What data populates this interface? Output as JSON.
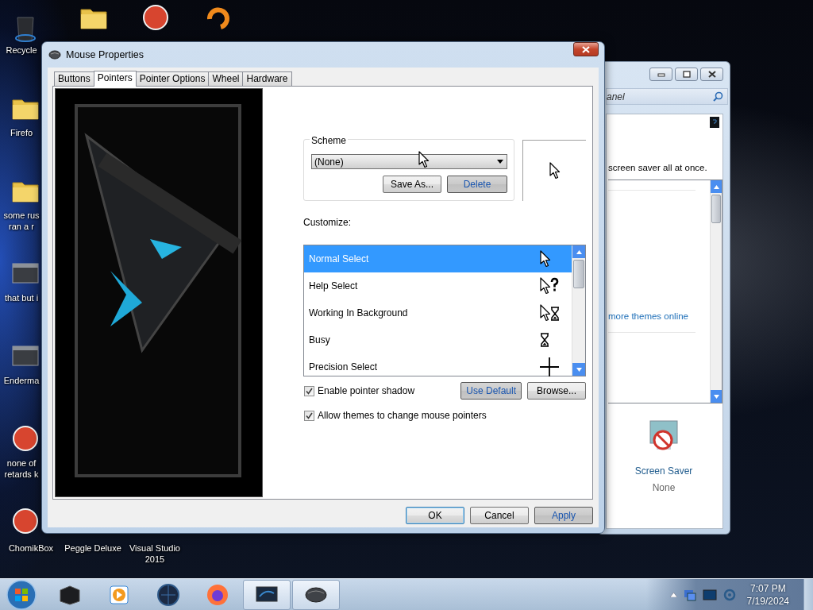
{
  "desktop_icons": [
    {
      "kind": "bin",
      "lines": [
        "Recycle"
      ]
    },
    {
      "kind": "folder",
      "lines": [
        "Firefo"
      ]
    },
    {
      "kind": "folder",
      "lines": [
        "some rus",
        "ran a r"
      ]
    },
    {
      "kind": "window",
      "lines": [
        "that but i"
      ]
    },
    {
      "kind": "window",
      "lines": [
        "Enderma"
      ]
    },
    {
      "kind": "app",
      "lines": [
        "none of",
        "retards k"
      ]
    },
    {
      "kind": "app",
      "lines": [
        "ChomikBox"
      ]
    },
    {
      "kind": "folder"
    },
    {
      "kind": "app"
    },
    {
      "kind": "ring"
    },
    {
      "lines": [
        "Peggle Deluxe"
      ]
    },
    {
      "lines": [
        "Visual Studio",
        "2015"
      ]
    }
  ],
  "background_window": {
    "search_placeholder": "anel",
    "description": "screen saver all at once.",
    "link": "more themes online",
    "screen_saver": {
      "label": "Screen Saver",
      "value": "None"
    }
  },
  "dialog": {
    "title": "Mouse Properties",
    "tabs": [
      {
        "label": "Buttons",
        "selected": false
      },
      {
        "label": "Pointers",
        "selected": true
      },
      {
        "label": "Pointer Options",
        "selected": false
      },
      {
        "label": "Wheel",
        "selected": false
      },
      {
        "label": "Hardware",
        "selected": false
      }
    ],
    "scheme": {
      "label": "Scheme",
      "value": "(None)",
      "buttons": [
        {
          "label": "Save As...",
          "disabled": false
        },
        {
          "label": "Delete",
          "disabled": true
        }
      ]
    },
    "customize_label": "Customize:",
    "pointers": [
      {
        "name": "Normal Select",
        "kind": "arrow",
        "selected": true
      },
      {
        "name": "Help Select",
        "kind": "help",
        "selected": false
      },
      {
        "name": "Working In Background",
        "kind": "working",
        "selected": false
      },
      {
        "name": "Busy",
        "kind": "busy",
        "selected": false
      },
      {
        "name": "Precision Select",
        "kind": "cross",
        "selected": false
      }
    ],
    "options": [
      {
        "label": "Enable pointer shadow",
        "checked": true
      },
      {
        "label": "Allow themes to change mouse pointers",
        "checked": true
      }
    ],
    "pointer_buttons": [
      {
        "label": "Use Default",
        "disabled": true
      },
      {
        "label": "Browse...",
        "disabled": false
      }
    ],
    "footer_buttons": [
      {
        "label": "OK",
        "disabled": false,
        "default": true
      },
      {
        "label": "Cancel",
        "disabled": false,
        "default": false
      },
      {
        "label": "Apply",
        "disabled": true,
        "default": false
      }
    ]
  },
  "taskbar": {
    "buttons": [
      {
        "kind": "box",
        "active": false
      },
      {
        "kind": "media",
        "active": false
      },
      {
        "kind": "globe",
        "active": false
      },
      {
        "kind": "browser",
        "active": false
      },
      {
        "kind": "monitor",
        "active": true
      },
      {
        "kind": "mouse",
        "active": true
      }
    ],
    "clock": {
      "time": "7:07 PM",
      "date": "7/19/2024"
    }
  }
}
